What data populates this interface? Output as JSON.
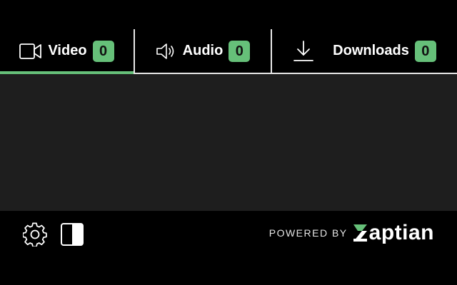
{
  "tabs": [
    {
      "label": "Video",
      "count": "0",
      "icon": "video-camera-icon",
      "active": true
    },
    {
      "label": "Audio",
      "count": "0",
      "icon": "speaker-icon",
      "active": false
    },
    {
      "label": "Downloads",
      "count": "0",
      "icon": "download-icon",
      "active": false
    }
  ],
  "footer": {
    "settings_icon": "gear-icon",
    "theme_icon": "contrast-icon",
    "powered_by": "POWERED BY",
    "brand_rest": "aptian"
  },
  "colors": {
    "accent": "#66c079",
    "panel": "#1e1e1e",
    "background": "#000000"
  }
}
